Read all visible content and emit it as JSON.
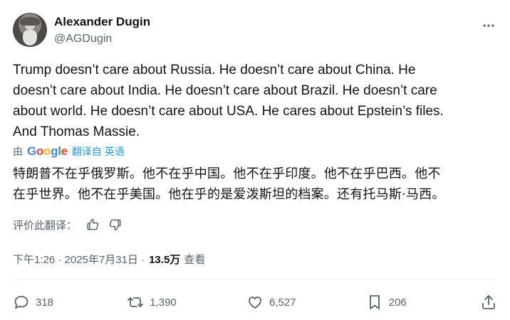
{
  "author": {
    "name": "Alexander Dugin",
    "handle": "@AGDugin"
  },
  "tweet": {
    "text": "Trump doesn’t care about Russia. He doesn’t care about China. He\ndoesn’t care about India. He doesn’t care about Brazil. He doesn’t care\nabout world. He doesn’t care about USA. He cares about Epstein’s files.\nAnd Thomas Massie."
  },
  "translation": {
    "prefix": "由",
    "provider": "Google",
    "label": "翻译自 英语",
    "text": "特朗普不在乎俄罗斯。他不在乎中国。他不在乎印度。他不在乎巴西。他不\n在乎世界。他不在乎美国。他在乎的是爱泼斯坦的档案。还有托马斯·马西。"
  },
  "rating": {
    "label": "评价此翻译："
  },
  "meta": {
    "timestamp": "下午1:26 · 2025年7月31日 ·",
    "views_count": "13.5万",
    "views_label": "查看"
  },
  "actions": {
    "replies": "318",
    "reposts": "1,390",
    "likes": "6,527",
    "bookmarks": "206"
  },
  "icons": [
    "more-icon",
    "thumbs-up-icon",
    "thumbs-down-icon",
    "reply-icon",
    "repost-icon",
    "like-icon",
    "bookmark-icon",
    "share-icon"
  ],
  "colors": {
    "text": "#0f1419",
    "secondary": "#536471",
    "link": "#1d9bf0",
    "divider": "#eff3f4",
    "google_blue": "#4285f4",
    "google_red": "#ea4335",
    "google_yellow": "#fbbc05",
    "google_green": "#34a853"
  }
}
